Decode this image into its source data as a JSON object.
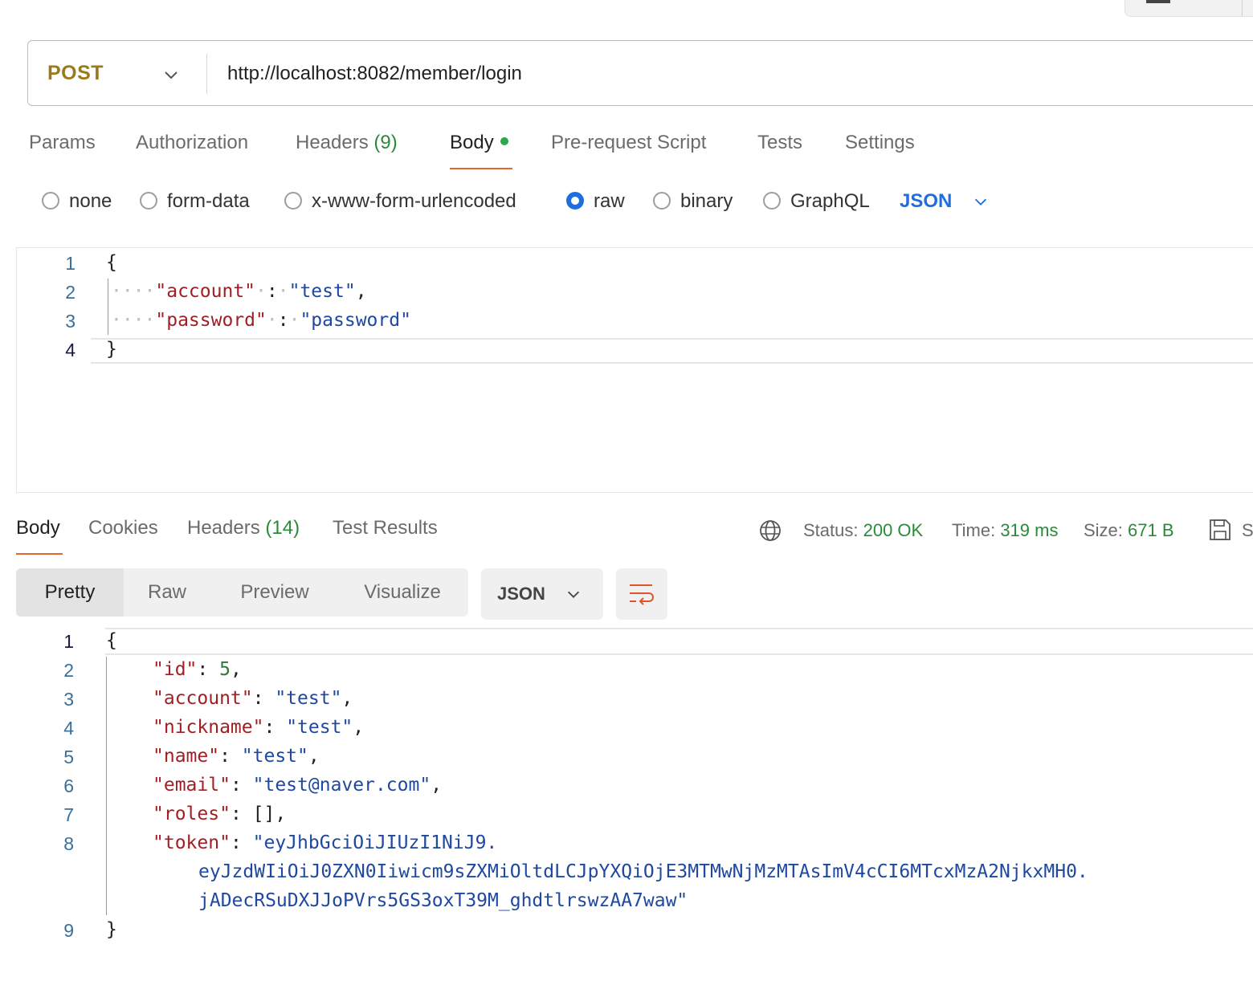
{
  "request": {
    "method": "POST",
    "url": "http://localhost:8082/member/login"
  },
  "request_tabs": [
    {
      "label": "Params"
    },
    {
      "label": "Authorization"
    },
    {
      "label": "Headers",
      "count": "(9)"
    },
    {
      "label": "Body"
    },
    {
      "label": "Pre-request Script"
    },
    {
      "label": "Tests"
    },
    {
      "label": "Settings"
    }
  ],
  "body_types": [
    "none",
    "form-data",
    "x-www-form-urlencoded",
    "raw",
    "binary",
    "GraphQL"
  ],
  "body_selected": "raw",
  "body_language": "JSON",
  "request_body": {
    "line_numbers": [
      "1",
      "2",
      "3",
      "4"
    ],
    "open": "{",
    "close": "}",
    "account_key": "\"account\"",
    "account_value": "\"test\"",
    "password_key": "\"password\"",
    "password_value": "\"password\""
  },
  "response_tabs": [
    {
      "label": "Body"
    },
    {
      "label": "Cookies"
    },
    {
      "label": "Headers",
      "count": "(14)"
    },
    {
      "label": "Test Results"
    }
  ],
  "response_meta": {
    "status_label": "Status:",
    "status_value": "200 OK",
    "time_label": "Time:",
    "time_value": "319 ms",
    "size_label": "Size:",
    "size_value": "671 B",
    "save_label_clipped": "S"
  },
  "view_modes": [
    "Pretty",
    "Raw",
    "Preview",
    "Visualize"
  ],
  "response_format": "JSON",
  "response_body": {
    "line_numbers": [
      "1",
      "2",
      "3",
      "4",
      "5",
      "6",
      "7",
      "8",
      "9"
    ],
    "open": "{",
    "close": "}",
    "id_key": "\"id\"",
    "id_value": "5",
    "account_key": "\"account\"",
    "account_value": "\"test\"",
    "nickname_key": "\"nickname\"",
    "nickname_value": "\"test\"",
    "name_key": "\"name\"",
    "name_value": "\"test\"",
    "email_key": "\"email\"",
    "email_value": "\"test@naver.com\"",
    "roles_key": "\"roles\"",
    "roles_value": "[]",
    "token_key": "\"token\"",
    "token_line1": "\"eyJhbGciOiJIUzI1NiJ9.",
    "token_line2": "eyJzdWIiOiJ0ZXN0Iiwicm9sZXMiOltdLCJpYXQiOjE3MTMwNjMzMTAsImV4cCI6MTcxMzA2NjkxMH0.",
    "token_line3": "jADecRSuDXJJoPVrs5GS3oxT39M_ghdtlrswzAA7waw\""
  },
  "icons": {
    "method_dropdown": "chevron-down-icon",
    "globe": "globe-icon",
    "save": "save-icon",
    "wrap": "wrap-lines-icon"
  },
  "colors": {
    "method": "#9b7a1c",
    "accent": "#e8652b",
    "ok": "#2a8a3a",
    "link": "#1f6ee0",
    "json_key": "#a01f24",
    "json_string": "#1f48a0"
  }
}
